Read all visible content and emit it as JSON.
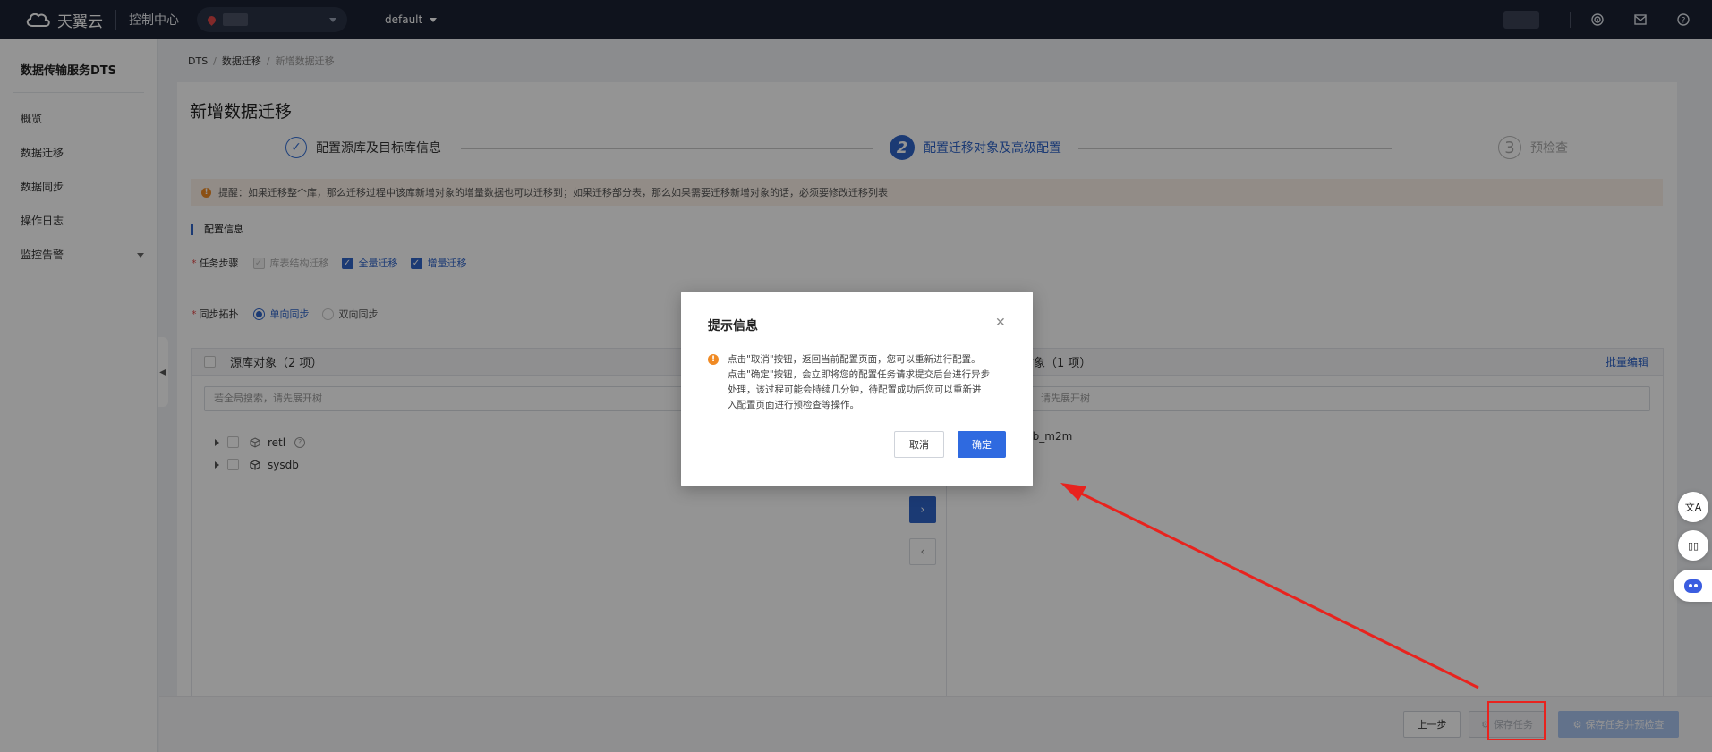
{
  "topbar": {
    "brand": "天翼云",
    "console": "控制中心",
    "project": "default"
  },
  "sidebar": {
    "title": "数据传输服务DTS",
    "items": [
      {
        "label": "概览"
      },
      {
        "label": "数据迁移"
      },
      {
        "label": "数据同步"
      },
      {
        "label": "操作日志"
      },
      {
        "label": "监控告警"
      }
    ]
  },
  "breadcrumb": {
    "items": [
      "DTS",
      "数据迁移",
      "新增数据迁移"
    ]
  },
  "page": {
    "title": "新增数据迁移",
    "steps": [
      {
        "num": "✓",
        "label": "配置源库及目标库信息",
        "state": "done"
      },
      {
        "num": "2",
        "label": "配置迁移对象及高级配置",
        "state": "active"
      },
      {
        "num": "3",
        "label": "预检查",
        "state": "todo"
      }
    ],
    "alert": "提醒：如果迁移整个库，那么迁移过程中该库新增对象的增量数据也可以迁移到；如果迁移部分表，那么如果需要迁移新增对象的话，必须要修改迁移列表",
    "section_title": "配置信息",
    "task_steps": {
      "label": "任务步骤",
      "options": [
        "库表结构迁移",
        "全量迁移",
        "增量迁移"
      ]
    },
    "sync_topology": {
      "label": "同步拓扑",
      "options": [
        "单向同步",
        "双向同步"
      ]
    },
    "source_panel": {
      "title": "源库对象（2 项）",
      "search_placeholder": "若全局搜索，请先展开树",
      "items": [
        "retl",
        "sysdb"
      ]
    },
    "target_panel": {
      "title": "对象（1 项）",
      "batch_edit": "批量编辑",
      "search_placeholder": "请先展开树",
      "items": [
        "2b_m2m"
      ]
    },
    "buttons": {
      "prev": "上一步",
      "save": "保存任务",
      "save_check": "保存任务并预检查"
    }
  },
  "modal": {
    "title": "提示信息",
    "lines": [
      "点击\"取消\"按钮，返回当前配置页面，您可以重新进行配置。",
      "点击\"确定\"按钮，会立即将您的配置任务请求提交后台进行异步",
      "处理，该过程可能会持续几分钟，待配置成功后您可以重新进",
      "入配置页面进行预检查等操作。"
    ],
    "cancel": "取消",
    "ok": "确定"
  },
  "icons": {
    "accent": "#2f64c9",
    "warning": "#f08a24",
    "annotation": "#e8231e"
  }
}
